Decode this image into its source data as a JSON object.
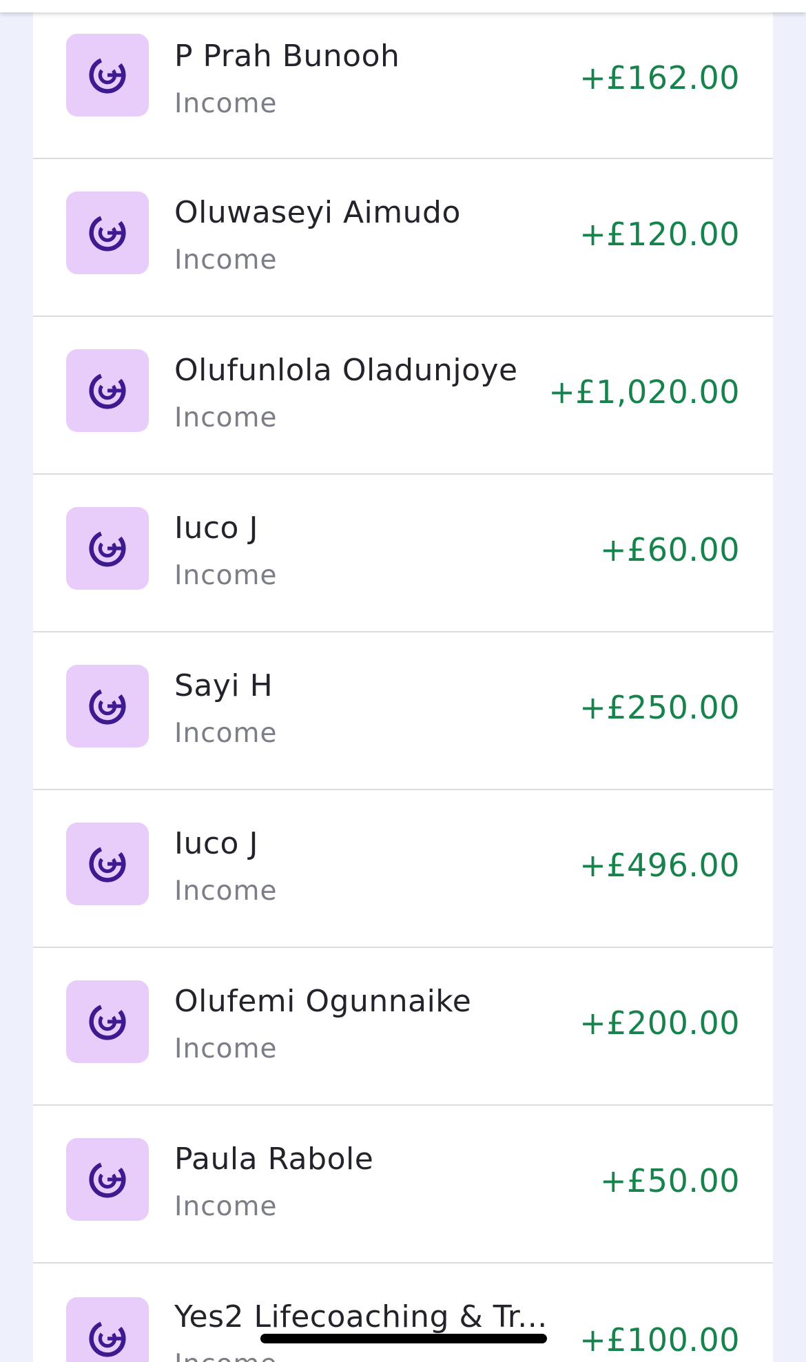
{
  "transactions": [
    {
      "name": "P Prah Bunooh",
      "category": "Income",
      "amount": "+£162.00"
    },
    {
      "name": "Oluwaseyi Aimudo",
      "category": "Income",
      "amount": "+£120.00"
    },
    {
      "name": "Olufunlola Oladunjoye",
      "category": "Income",
      "amount": "+£1,020.00"
    },
    {
      "name": "Iuco J",
      "category": "Income",
      "amount": "+£60.00"
    },
    {
      "name": "Sayi H",
      "category": "Income",
      "amount": "+£250.00"
    },
    {
      "name": "Iuco J",
      "category": "Income",
      "amount": "+£496.00"
    },
    {
      "name": "Olufemi Ogunnaike",
      "category": "Income",
      "amount": "+£200.00"
    },
    {
      "name": "Paula Rabole",
      "category": "Income",
      "amount": "+£50.00"
    },
    {
      "name": "Yes2 Lifecoaching & Tr...",
      "category": "Income",
      "amount": "+£100.00"
    }
  ],
  "icon": {
    "name": "income-category-icon",
    "tile_color": "#e8cdfa",
    "glyph_color": "#3d1a8f"
  },
  "colors": {
    "amount_positive": "#17834c",
    "background": "#eef1fb"
  }
}
